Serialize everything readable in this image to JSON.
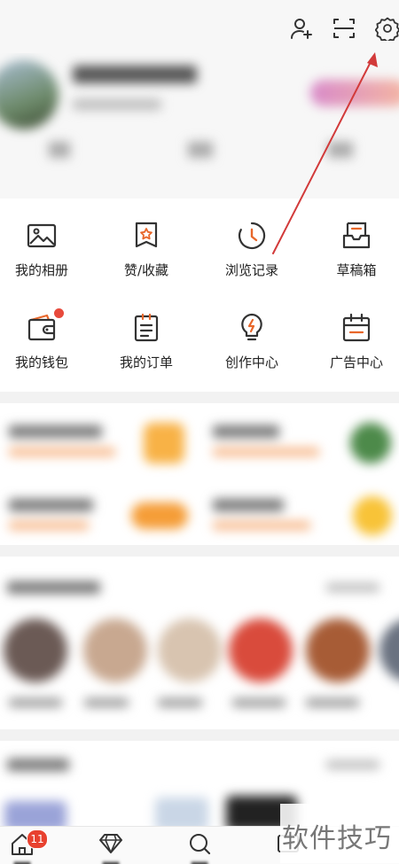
{
  "header": {
    "icons": [
      "add-user-icon",
      "scan-icon",
      "gear-icon"
    ]
  },
  "grid": {
    "items": [
      {
        "label": "我的相册",
        "icon": "photo-album-icon"
      },
      {
        "label": "赞/收藏",
        "icon": "like-bookmark-icon"
      },
      {
        "label": "浏览记录",
        "icon": "history-clock-icon"
      },
      {
        "label": "草稿箱",
        "icon": "drafts-tray-icon"
      },
      {
        "label": "我的钱包",
        "icon": "wallet-icon"
      },
      {
        "label": "我的订单",
        "icon": "order-list-icon"
      },
      {
        "label": "创作中心",
        "icon": "creator-bulb-icon"
      },
      {
        "label": "广告中心",
        "icon": "ad-calendar-icon"
      }
    ]
  },
  "tabbar": {
    "badge_count": "11"
  },
  "watermark": {
    "text": "软件技巧"
  },
  "colors": {
    "accent": "#e8672a",
    "badge": "#e8412f",
    "annotation_arrow": "#d23a3a"
  }
}
